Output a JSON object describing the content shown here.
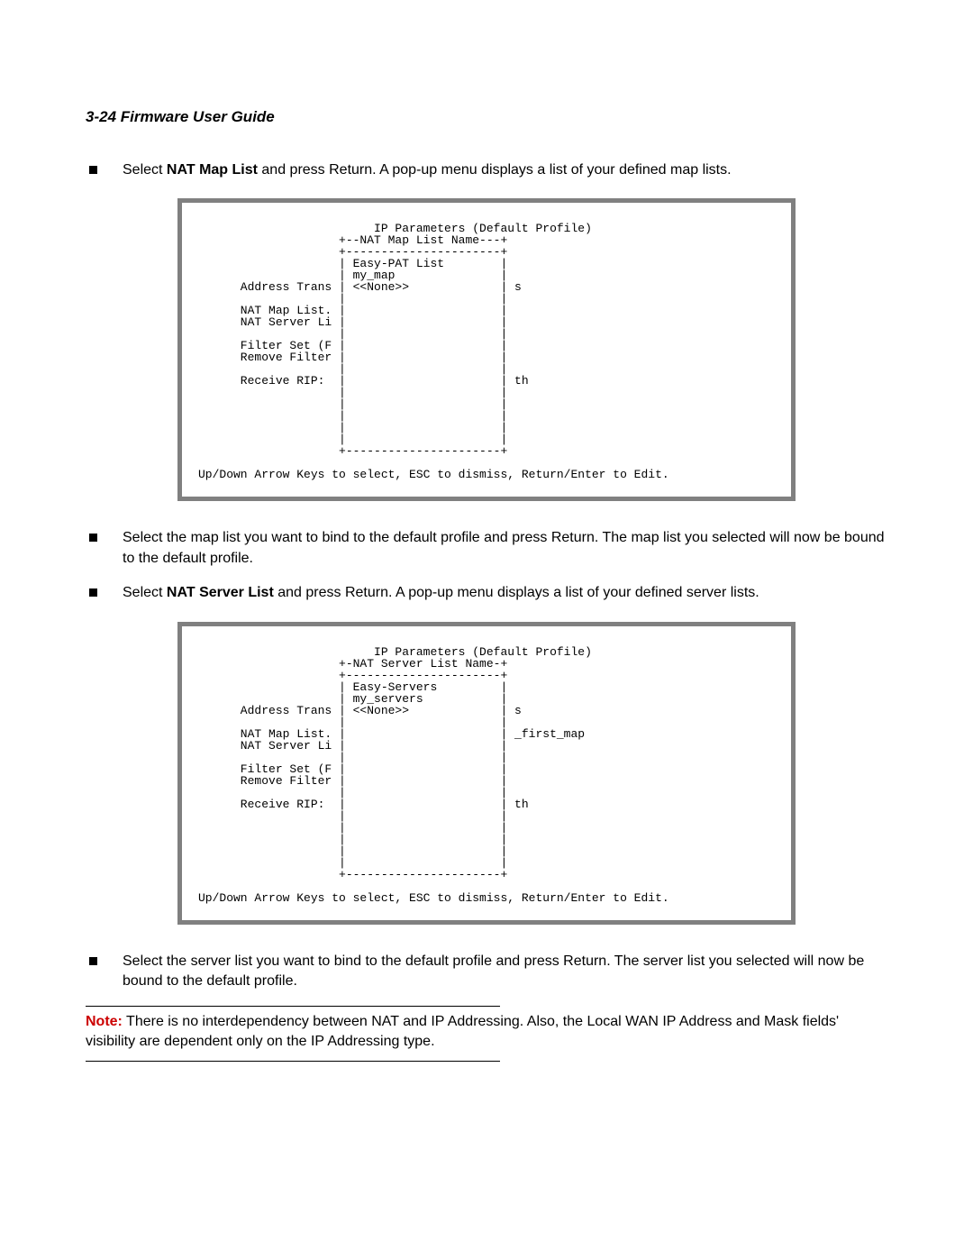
{
  "header": "3-24  Firmware User Guide",
  "bullets": {
    "b1_pre": "Select ",
    "b1_bold": "NAT Map List",
    "b1_post": " and press Return. A pop-up menu displays a list of your defined map lists.",
    "b2": "Select the map list you want to bind to the default profile and press Return. The map list you selected will now be bound to the default profile.",
    "b3_pre": "Select ",
    "b3_bold": "NAT Server List",
    "b3_post": " and press Return. A pop-up menu displays a list of your defined server lists.",
    "b4": "Select the server list you want to bind to the default profile and press Return. The server list you selected will now be bound to the default profile."
  },
  "terminal1": "                         IP Parameters (Default Profile)\n                    +--NAT Map List Name---+\n                    +----------------------+\n                    | Easy-PAT List        |\n                    | my_map               |\n      Address Trans | <<None>>             | s\n                    |                      |\n      NAT Map List. |                      |\n      NAT Server Li |                      |\n                    |                      |\n      Filter Set (F |                      |\n      Remove Filter |                      |\n                    |                      |\n      Receive RIP:  |                      | th\n                    |                      |\n                    |                      |\n                    |                      |\n                    |                      |\n                    |                      |\n                    +----------------------+\n\nUp/Down Arrow Keys to select, ESC to dismiss, Return/Enter to Edit.",
  "terminal2": "                         IP Parameters (Default Profile)\n                    +-NAT Server List Name-+\n                    +----------------------+\n                    | Easy-Servers         |\n                    | my_servers           |\n      Address Trans | <<None>>             | s\n                    |                      |\n      NAT Map List. |                      | _first_map\n      NAT Server Li |                      |\n                    |                      |\n      Filter Set (F |                      |\n      Remove Filter |                      |\n                    |                      |\n      Receive RIP:  |                      | th\n                    |                      |\n                    |                      |\n                    |                      |\n                    |                      |\n                    |                      |\n                    +----------------------+\n\nUp/Down Arrow Keys to select, ESC to dismiss, Return/Enter to Edit.",
  "note": {
    "label": "Note:",
    "text": "  There is no interdependency between NAT and IP Addressing. Also, the Local WAN IP Address and Mask fields' visibility are dependent only on the IP Addressing type."
  }
}
